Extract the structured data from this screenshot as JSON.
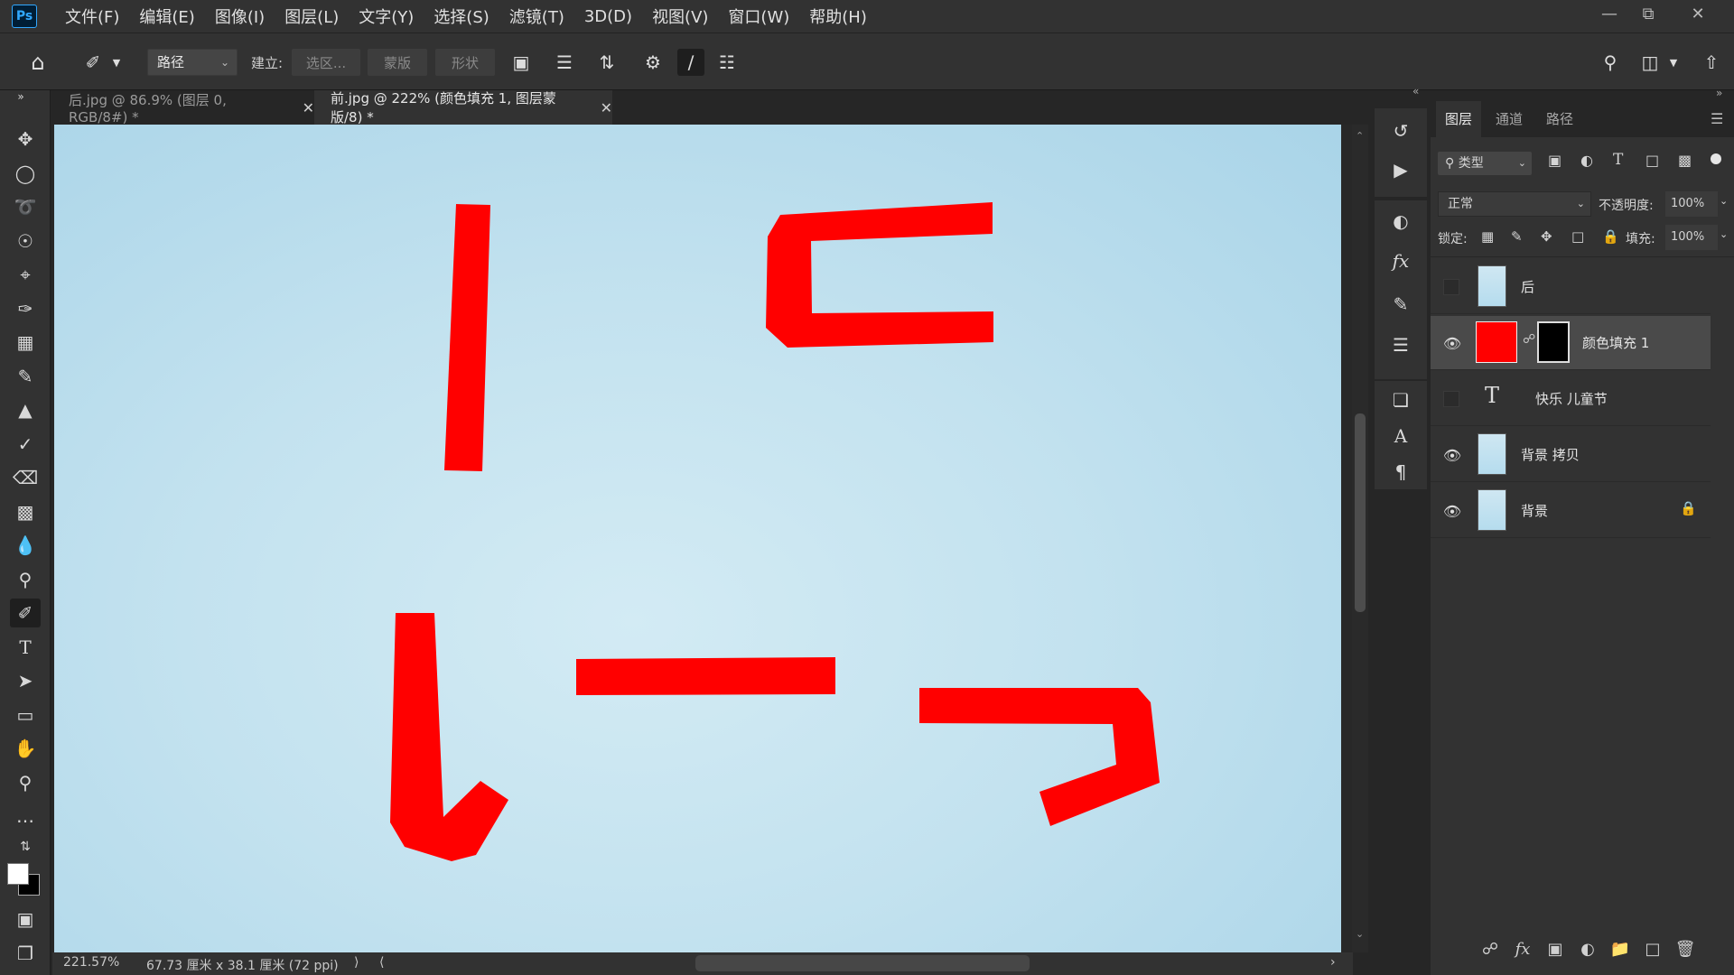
{
  "app": {
    "logo": "Ps"
  },
  "menu": [
    "文件(F)",
    "编辑(E)",
    "图像(I)",
    "图层(L)",
    "文字(Y)",
    "选择(S)",
    "滤镜(T)",
    "3D(D)",
    "视图(V)",
    "窗口(W)",
    "帮助(H)"
  ],
  "options": {
    "mode_select": "路径",
    "build_label": "建立:",
    "selection_btn": "选区...",
    "mask_btn": "蒙版",
    "shape_btn": "形状"
  },
  "tabs": [
    {
      "label": "后.jpg @ 86.9% (图层 0, RGB/8#) *",
      "active": false
    },
    {
      "label": "前.jpg @ 222% (颜色填充 1, 图层蒙版/8) *",
      "active": true
    }
  ],
  "status": {
    "zoom": "221.57%",
    "doc_size": "67.73 厘米 x 38.1 厘米 (72 ppi)"
  },
  "layers_panel": {
    "tabs": [
      "图层",
      "通道",
      "路径"
    ],
    "filter_label": "类型",
    "blend_mode": "正常",
    "opacity_label": "不透明度:",
    "opacity_value": "100%",
    "lock_label": "锁定:",
    "fill_label": "填充:",
    "fill_value": "100%",
    "layers": [
      {
        "name": "后",
        "visible": false,
        "kind": "image"
      },
      {
        "name": "颜色填充 1",
        "visible": true,
        "kind": "fill",
        "selected": true
      },
      {
        "name": "快乐 儿童节",
        "visible": false,
        "kind": "text"
      },
      {
        "name": "背景 拷贝",
        "visible": true,
        "kind": "image"
      },
      {
        "name": "背景",
        "visible": true,
        "kind": "image",
        "locked": true
      }
    ]
  },
  "colors": {
    "fill_red": "#ff0000",
    "canvas_blue": "#c3e2ef",
    "ui_dark": "#323232"
  }
}
